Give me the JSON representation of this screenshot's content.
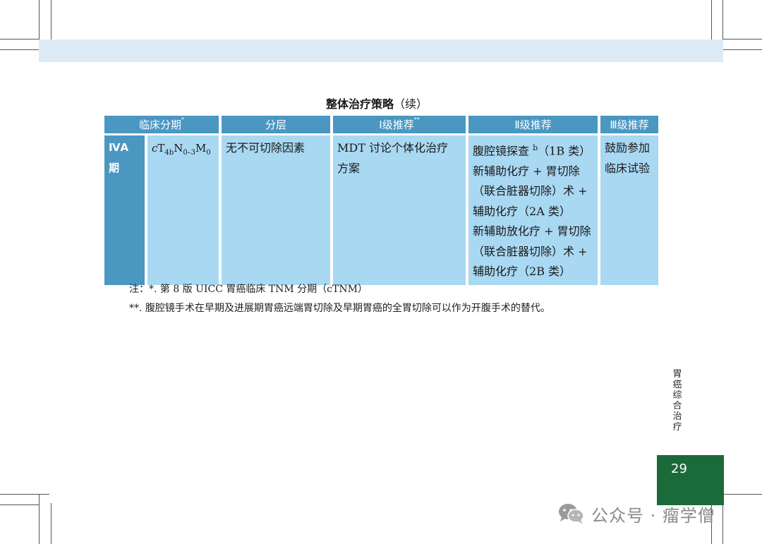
{
  "table": {
    "title": "整体治疗策略",
    "title_suffix": "（续）",
    "headers": {
      "stage": "临床分期",
      "stage_mark": "*",
      "layer": "分层",
      "level1": "Ⅰ级推荐",
      "level1_mark": "**",
      "level2": "Ⅱ级推荐",
      "level3": "Ⅲ级推荐"
    },
    "row": {
      "stage_line1": "ⅣA",
      "stage_line2": "期",
      "tnm": {
        "c": "c",
        "t": "T",
        "t_sub": "4b",
        "n": "N",
        "n_sub": "0–3",
        "m": "M",
        "m_sub": "0"
      },
      "layer": "无不可切除因素",
      "level1_line1": "MDT 讨论个体化治疗",
      "level1_line2": "方案",
      "level2_line1": "腹腔镜探查",
      "level2_line1_sup": "b",
      "level2_line1_end": "（1B 类）",
      "level2_line2": "新辅助化疗 + 胃切除",
      "level2_line3": "（联合脏器切除）术 +",
      "level2_line4": "辅助化疗（2A 类）",
      "level2_line5": "新辅助放化疗 + 胃切除",
      "level2_line6": "（联合脏器切除）术 +",
      "level2_line7": "辅助化疗（2B 类）",
      "level3_line1": "鼓励参加",
      "level3_line2": "临床试验"
    }
  },
  "notes": {
    "note1": "注：*. 第 8 版 UICC 胃癌临床 TNM 分期（cTNM）",
    "note2": "**. 腹腔镜手术在早期及进展期胃癌远端胃切除及早期胃癌的全胃切除可以作为开腹手术的替代。"
  },
  "side_label": "胃癌综合治疗",
  "page_number": "29",
  "watermark": {
    "text": "公众号 · 瘤学僧",
    "icon": "wechat-icon"
  },
  "colors": {
    "header_band": "#dcebf6",
    "table_header": "#4a97c2",
    "table_cell": "#a9d8f2",
    "page_box": "#1a6a3a"
  }
}
